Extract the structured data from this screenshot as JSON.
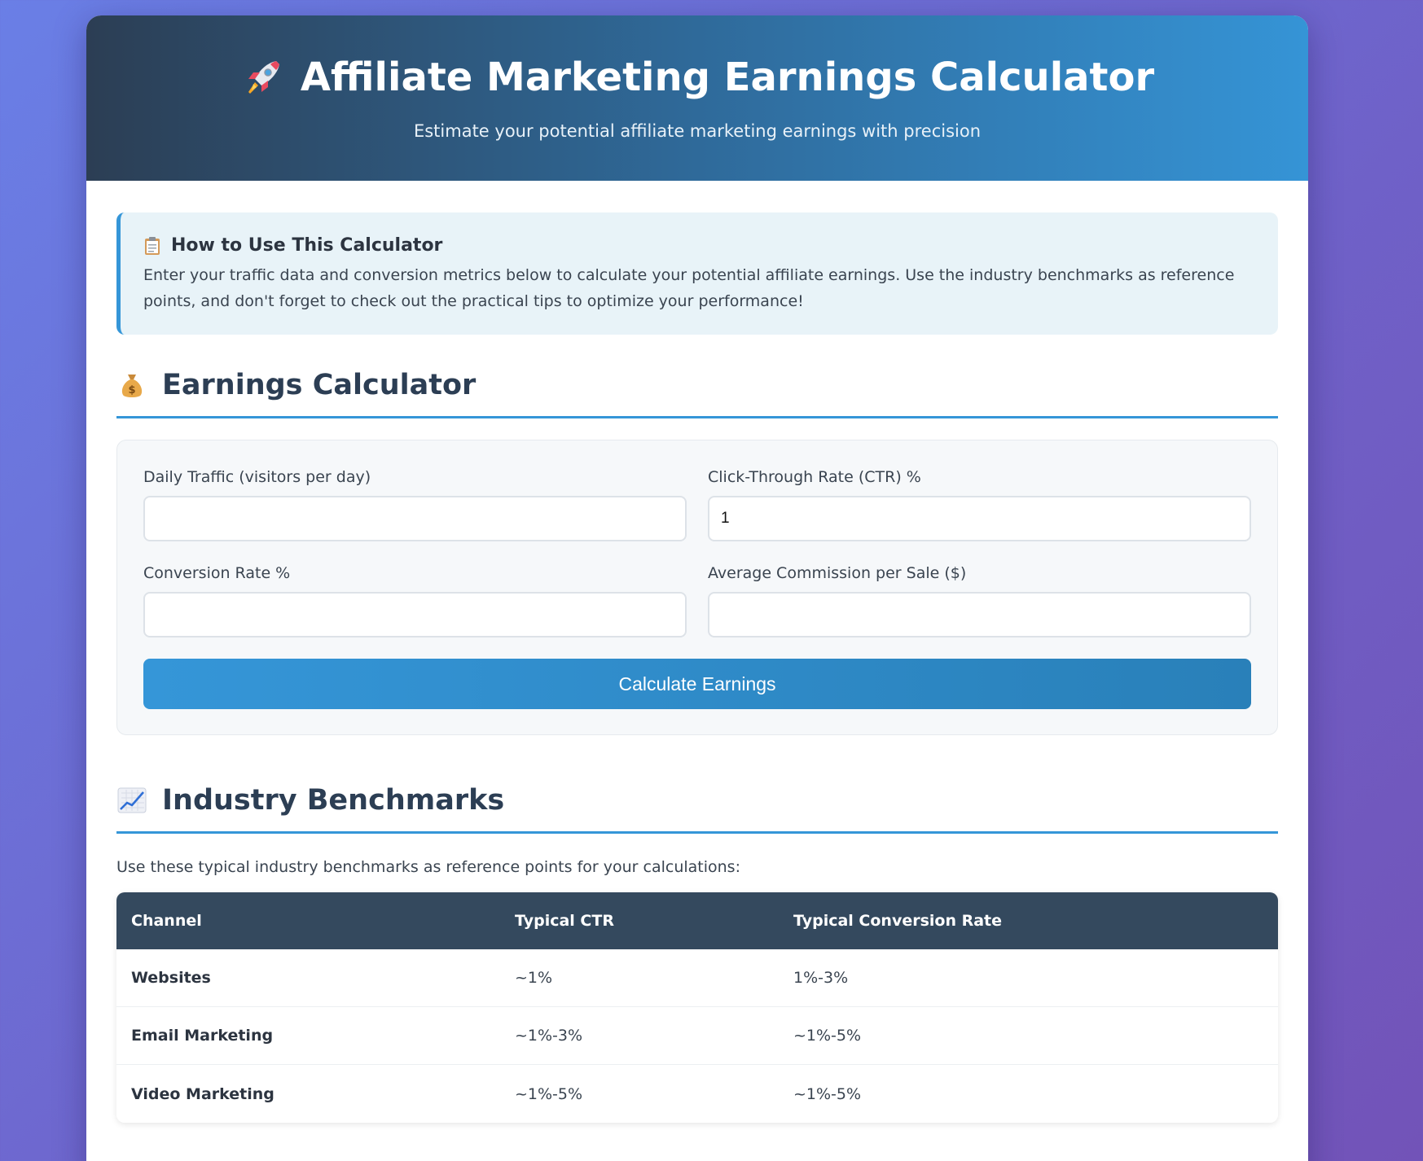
{
  "header": {
    "title": "Affiliate Marketing Earnings Calculator",
    "subtitle": "Estimate your potential affiliate marketing earnings with precision",
    "icon": "rocket-icon"
  },
  "info": {
    "title": "How to Use This Calculator",
    "text": "Enter your traffic data and conversion metrics below to calculate your potential affiliate earnings. Use the industry benchmarks as reference points, and don't forget to check out the practical tips to optimize your performance!",
    "icon": "clipboard-icon"
  },
  "calculator": {
    "title": "Earnings Calculator",
    "icon": "money-bag-icon",
    "fields": {
      "traffic": {
        "label": "Daily Traffic (visitors per day)",
        "value": ""
      },
      "ctr": {
        "label": "Click-Through Rate (CTR) %",
        "value": "1"
      },
      "conversion": {
        "label": "Conversion Rate %",
        "value": ""
      },
      "commission": {
        "label": "Average Commission per Sale ($)",
        "value": ""
      }
    },
    "button_label": "Calculate Earnings"
  },
  "benchmarks": {
    "title": "Industry Benchmarks",
    "icon": "chart-increasing-icon",
    "intro": "Use these typical industry benchmarks as reference points for your calculations:",
    "columns": [
      "Channel",
      "Typical CTR",
      "Typical Conversion Rate"
    ],
    "rows": [
      {
        "channel": "Websites",
        "ctr": "~1%",
        "conversion": "1%-3%"
      },
      {
        "channel": "Email Marketing",
        "ctr": "~1%-3%",
        "conversion": "~1%-5%"
      },
      {
        "channel": "Video Marketing",
        "ctr": "~1%-5%",
        "conversion": "~1%-5%"
      }
    ]
  },
  "colors": {
    "accent": "#3596d8",
    "header_dark": "#2c3e54",
    "table_header": "#34495e"
  }
}
